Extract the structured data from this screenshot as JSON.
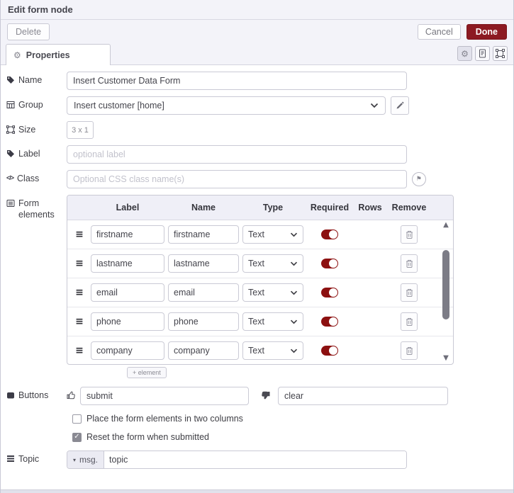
{
  "dialog": {
    "title": "Edit form node",
    "delete_label": "Delete",
    "cancel_label": "Cancel",
    "done_label": "Done"
  },
  "tab": {
    "properties_label": "Properties"
  },
  "fields": {
    "name": {
      "label": "Name",
      "value": "Insert Customer Data Form"
    },
    "group": {
      "label": "Group",
      "value": "Insert customer [home]"
    },
    "size": {
      "label": "Size",
      "value": "3 x 1"
    },
    "label_field": {
      "label": "Label",
      "placeholder": "optional label"
    },
    "css_class": {
      "label": "Class",
      "placeholder": "Optional CSS class name(s)"
    },
    "form_elements": {
      "label": "Form elements"
    },
    "buttons": {
      "label": "Buttons",
      "submit_value": "submit",
      "clear_value": "clear"
    },
    "topic": {
      "label": "Topic",
      "prefix": "msg.",
      "value": "topic"
    }
  },
  "form_elements_table": {
    "headers": [
      "Label",
      "Name",
      "Type",
      "Required",
      "Rows",
      "Remove"
    ],
    "rows": [
      {
        "label": "firstname",
        "name": "firstname",
        "type": "Text",
        "required": true
      },
      {
        "label": "lastname",
        "name": "lastname",
        "type": "Text",
        "required": true
      },
      {
        "label": "email",
        "name": "email",
        "type": "Text",
        "required": true
      },
      {
        "label": "phone",
        "name": "phone",
        "type": "Text",
        "required": true
      },
      {
        "label": "company",
        "name": "company",
        "type": "Text",
        "required": true
      }
    ],
    "add_button_label": "+ element"
  },
  "options": [
    {
      "label": "Place the form elements in two columns",
      "checked": false
    },
    {
      "label": "Reset the form when submitted",
      "checked": true
    }
  ],
  "colors": {
    "accent_red": "#8c1a22",
    "toggle_on": "#8c1010",
    "header_bg": "#f3f3f9",
    "table_header_bg": "#efeff7",
    "border": "#c9c9d4"
  }
}
